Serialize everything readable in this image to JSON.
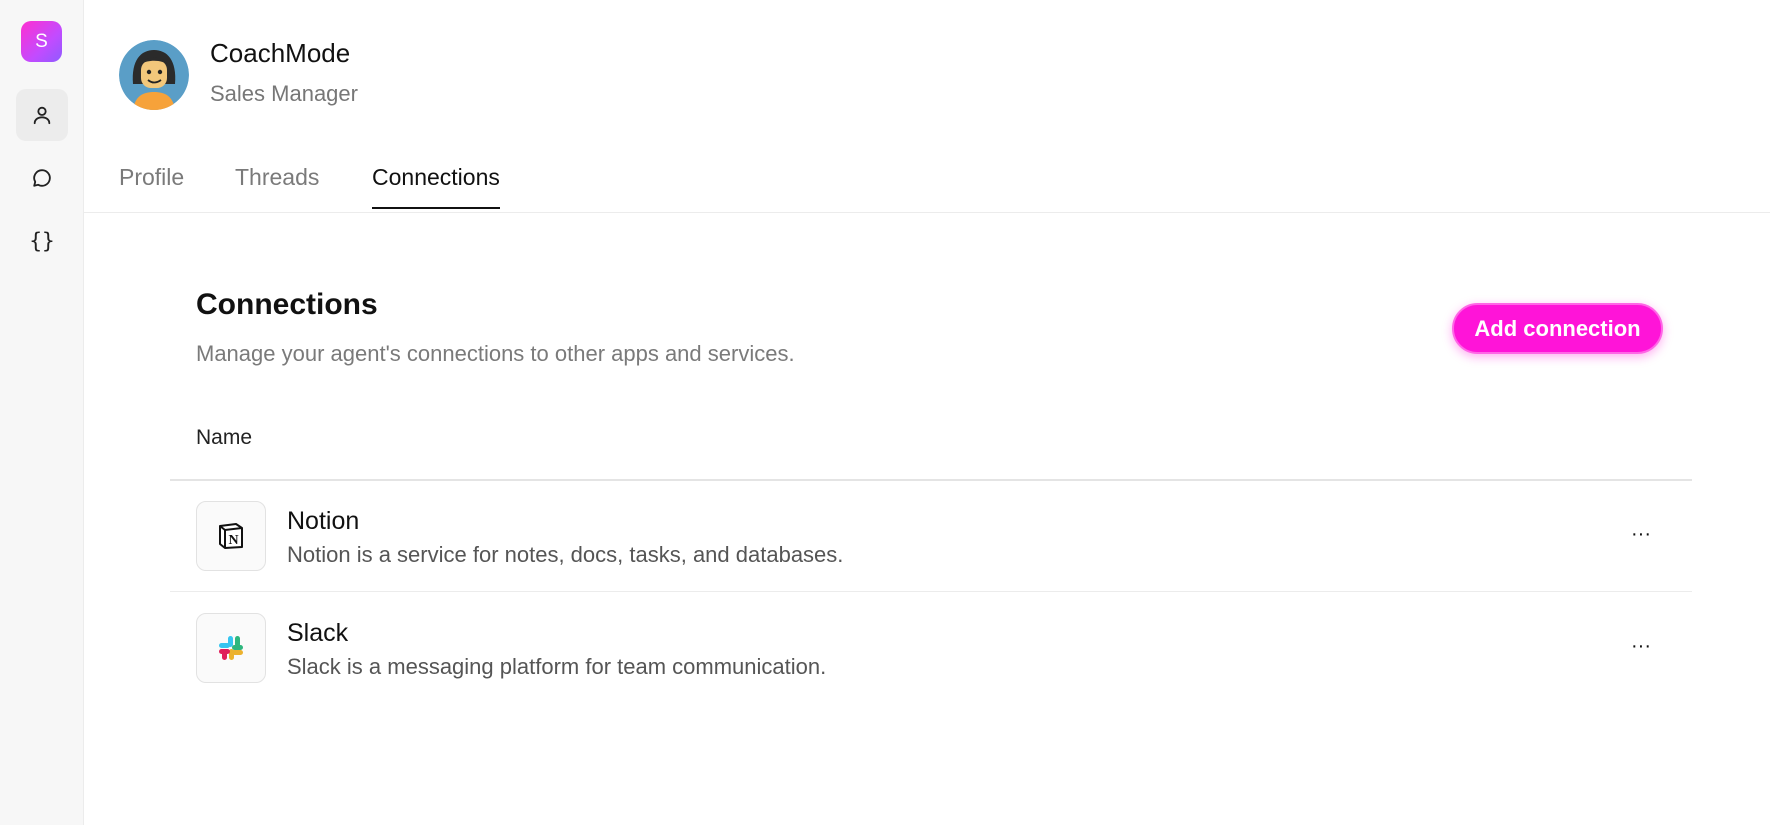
{
  "app": {
    "logo_letter": "S",
    "accent_color": "#ff14d8"
  },
  "sidebar": {
    "items": [
      {
        "icon": "user-icon",
        "active": true
      },
      {
        "icon": "chat-bubble-icon",
        "active": false
      },
      {
        "icon": "braces-icon",
        "active": false,
        "glyph": "{}"
      }
    ]
  },
  "agent": {
    "name": "CoachMode",
    "role": "Sales Manager"
  },
  "tabs": [
    {
      "label": "Profile",
      "active": false
    },
    {
      "label": "Threads",
      "active": false
    },
    {
      "label": "Connections",
      "active": true
    }
  ],
  "connections": {
    "title": "Connections",
    "description": "Manage your agent's connections to other apps and services.",
    "add_button_label": "Add connection",
    "column_header": "Name",
    "rows": [
      {
        "name": "Notion",
        "description": "Notion is a service for notes, docs, tasks, and databases.",
        "icon": "notion-icon",
        "menu": "···"
      },
      {
        "name": "Slack",
        "description": "Slack is a messaging platform for team communication.",
        "icon": "slack-icon",
        "menu": "···"
      }
    ]
  }
}
